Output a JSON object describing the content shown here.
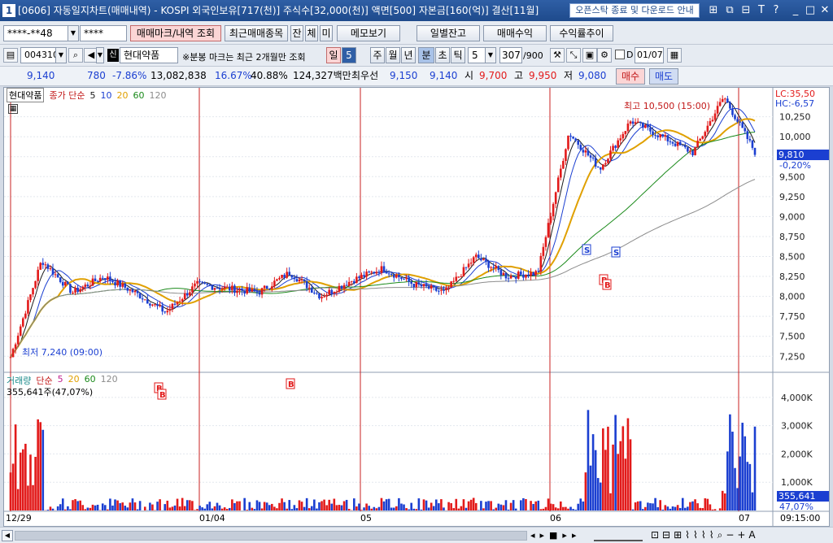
{
  "titlebar": {
    "window_number": "1",
    "title": "[0606] 자동일지차트(매매내역) - KOSPI 외국인보유[717(천)] 주식수[32,000(천)] 액면[500] 자본금[160(억)] 결산[11월]",
    "notice_button": "오픈스탁 종료 및 다운로드 안내",
    "icons": [
      "window-mode-icon",
      "restore-icon",
      "minimize-icon",
      "text-icon",
      "help-icon",
      "minimize-window-icon",
      "maximize-window-icon",
      "close-window-icon"
    ]
  },
  "toolbar1": {
    "account": "****-**48",
    "password": "****",
    "tab_trade_marks": "매매마크/내역 조회",
    "tab_recent_trades": "최근매매종목",
    "tab_balance": "잔",
    "tab_execution": "체",
    "tab_unfilled": "미",
    "memo": "메모보기",
    "daily_balance": "일별잔고",
    "trade_profit": "매매수익",
    "return_trend": "수익률추이"
  },
  "toolbar2": {
    "code": "004310",
    "stock_badge": "신",
    "stock_name": "현대약품",
    "note": "※분봉 마크는 최근 2개월만 조회",
    "period_day": "일",
    "period_value": "5",
    "period_week": "주",
    "period_month": "월",
    "period_year": "년",
    "period_min": "분",
    "period_sec": "초",
    "period_tick": "틱",
    "interval": "5",
    "count": "307",
    "max_count": "/900",
    "date_label": "D",
    "date": "01/07"
  },
  "info": {
    "price": "9,140",
    "change": "780",
    "change_pct": "-7.86%",
    "volume": "13,082,838",
    "ratio1": "16.67%",
    "ratio2": "40.88%",
    "amount": "124,327백만",
    "best_ask_label": "최우선",
    "best_ask": "9,150",
    "best_bid": "9,140",
    "open_label": "시",
    "open": "9,700",
    "high_label": "고",
    "high": "9,950",
    "low_label": "저",
    "low": "9,080",
    "buy": "매수",
    "sell": "매도"
  },
  "chart": {
    "stock_tag": "현대약품",
    "price_legend": [
      "종가 단순",
      "5",
      "10",
      "20",
      "60",
      "120"
    ],
    "volume_legend": [
      "거래량",
      "단순",
      "5",
      "20",
      "60",
      "120"
    ],
    "volume_current": "355,641주(47,07%)",
    "lc": "LC:35,50",
    "hc": "HC:-6,57",
    "high_annot": "최고 10,500 (15:00)",
    "low_annot": "최저 7,240 (09:00)",
    "price_ticks": [
      "10,250",
      "10,000",
      "9,750",
      "9,500",
      "9,250",
      "9,000",
      "8,750",
      "8,500",
      "8,250",
      "8,000",
      "7,750",
      "7,500",
      "7,250"
    ],
    "current_price": "9,810",
    "current_change": "-0,20%",
    "volume_ticks": [
      "4,000K",
      "3,000K",
      "2,000K",
      "1,000K"
    ],
    "volume_value": "355,641",
    "volume_pct": "47,07%",
    "date_labels": [
      "12/29",
      "01/04",
      "05",
      "06",
      "07"
    ],
    "time_label": "09:15:00",
    "marks": [
      "B",
      "B",
      "B",
      "S",
      "S",
      "B",
      "B"
    ],
    "colors": {
      "up": "#e21a1a",
      "down": "#1b3fd1",
      "ma5": "#1a1a1a",
      "ma10": "#1b3fd1",
      "ma20": "#e0a000",
      "ma60": "#1a8a1a",
      "ma120": "#8c8c8c",
      "vline": "#c82020"
    }
  },
  "chart_data": {
    "type": "candlestick",
    "title": "현대약품",
    "x": [
      "12/29",
      "01/04",
      "05",
      "06",
      "07"
    ],
    "price_range": [
      7240,
      10500
    ],
    "series": [
      {
        "name": "종가",
        "values": [
          7240,
          8450,
          8050,
          8250,
          8050,
          7800,
          8150,
          8100,
          8050,
          8300,
          8000,
          8200,
          8350,
          8150,
          8050,
          8500,
          8250,
          8300,
          10050,
          9600,
          10200,
          10000,
          9800,
          10500,
          9810
        ]
      }
    ],
    "volume_range": [
      0,
      4500000
    ],
    "volume_current": 355641
  },
  "bottombar": {
    "icons": [
      "nav-prev-icon",
      "play-icon",
      "stop-icon",
      "fast-forward-icon",
      "zoom-out-icon",
      "zoom-in-icon",
      "plus-icon",
      "text-a-icon"
    ]
  }
}
